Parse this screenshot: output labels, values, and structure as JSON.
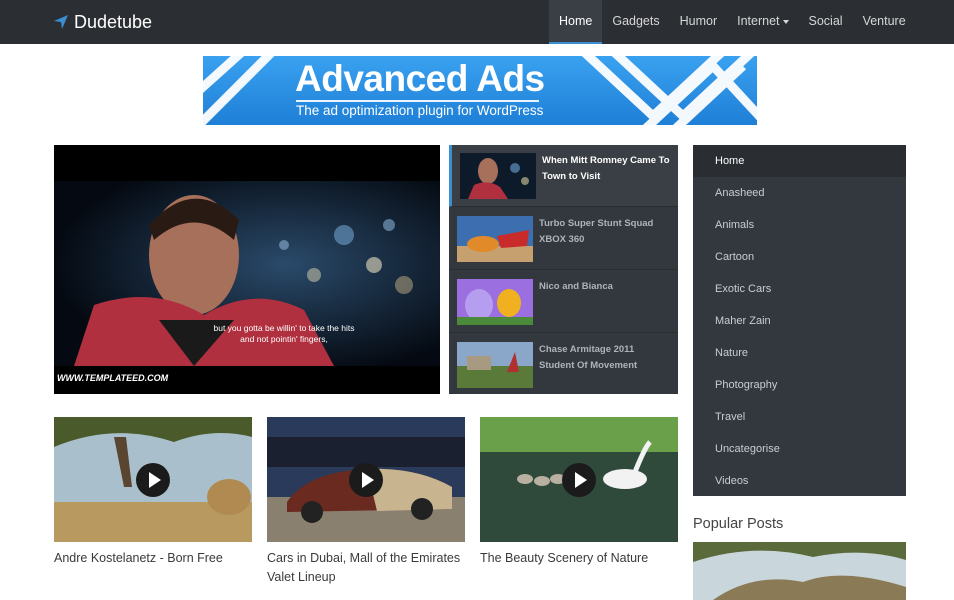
{
  "brand": {
    "name": "Dudetube",
    "icon": "navigation-arrow-icon"
  },
  "nav": {
    "items": [
      {
        "label": "Home",
        "active": true
      },
      {
        "label": "Gadgets"
      },
      {
        "label": "Humor"
      },
      {
        "label": "Internet",
        "dropdown": true
      },
      {
        "label": "Social"
      },
      {
        "label": "Venture"
      }
    ]
  },
  "banner": {
    "title": "Advanced Ads",
    "subtitle": "The ad optimization plugin for WordPress"
  },
  "featured": {
    "caption_line1": "but you gotta be willin' to take the hits",
    "caption_line2": "and not pointin' fingers,",
    "watermark": "WWW.TEMPLATEED.COM"
  },
  "video_list": [
    {
      "title": "When Mitt Romney Came To Town to Visit",
      "active": true
    },
    {
      "title": "Turbo Super Stunt Squad XBOX 360"
    },
    {
      "title": "Nico and Bianca"
    },
    {
      "title": "Chase Armitage 2011 Student Of Movement"
    }
  ],
  "categories": [
    "Home",
    "Anasheed",
    "Animals",
    "Cartoon",
    "Exotic Cars",
    "Maher Zain",
    "Nature",
    "Photography",
    "Travel",
    "Uncategorise",
    "Videos"
  ],
  "popular": {
    "title": "Popular Posts"
  },
  "cards": [
    {
      "title": "Andre Kostelanetz - Born Free"
    },
    {
      "title": "Cars in Dubai, Mall of the Emirates Valet Lineup"
    },
    {
      "title": "The Beauty Scenery of Nature"
    }
  ],
  "colors": {
    "topbar": "#2b2f34",
    "accent": "#3b8ed0",
    "panel": "#33383e"
  }
}
